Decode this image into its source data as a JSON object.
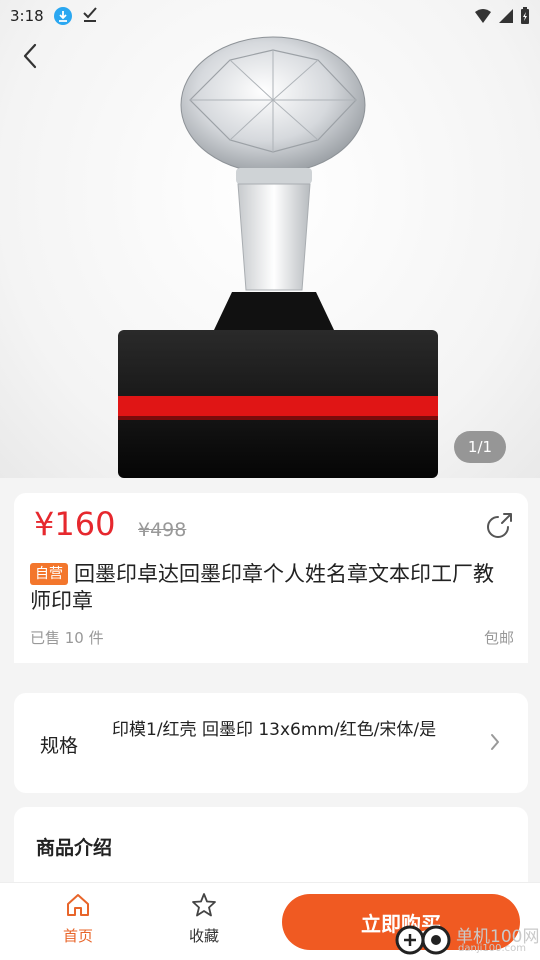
{
  "statusbar": {
    "time": "3:18"
  },
  "hero": {
    "pager": "1/1"
  },
  "product": {
    "price": "¥160",
    "old_price": "¥498",
    "tag": "自营",
    "title": "回墨印卓达回墨印章个人姓名章文本印工厂教师印章",
    "sold": "已售 10 件",
    "shipping": "包邮"
  },
  "spec": {
    "label": "规格",
    "value": "印模1/红壳 回墨印 13x6mm/红色/宋体/是"
  },
  "intro": {
    "title": "商品介绍"
  },
  "bottom_nav": {
    "home": "首页",
    "favorite": "收藏",
    "buy": "立即购买"
  },
  "watermark": {
    "text": "单机100网",
    "sub": "danji100.com"
  },
  "colors": {
    "accent": "#f05a22",
    "price": "#e6282e",
    "tag": "#f3762c"
  }
}
